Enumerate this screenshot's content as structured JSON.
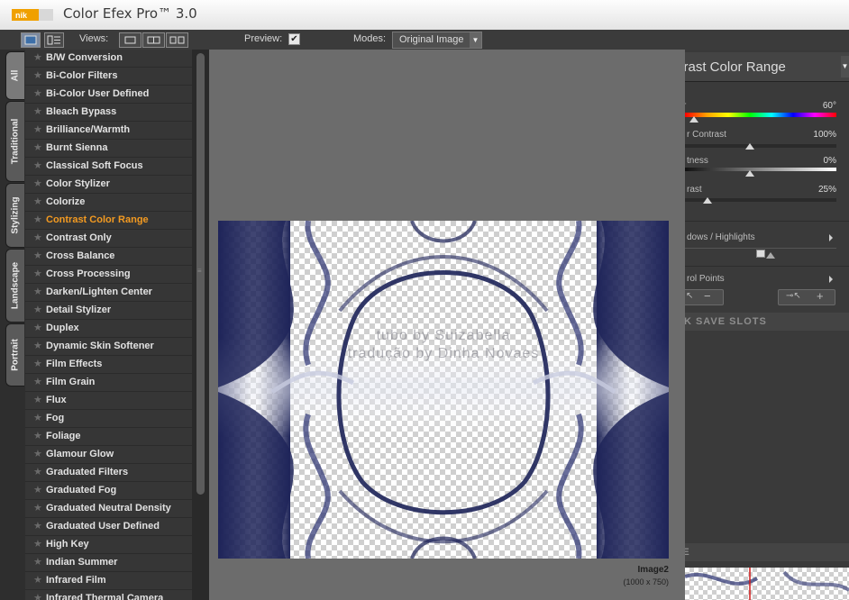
{
  "window": {
    "title": "Color Efex Pro™ 3.0",
    "logo": "nik"
  },
  "toolbar": {
    "views_label": "Views:",
    "preview_label": "Preview:",
    "preview_checked": "✔",
    "modes_label": "Modes:",
    "modes_value": "Original Image"
  },
  "tabs": [
    "All",
    "Traditional",
    "Stylizing",
    "Landscape",
    "Portrait"
  ],
  "filters": [
    "B/W Conversion",
    "Bi-Color Filters",
    "Bi-Color User Defined",
    "Bleach Bypass",
    "Brilliance/Warmth",
    "Burnt Sienna",
    "Classical Soft Focus",
    "Color Stylizer",
    "Colorize",
    "Contrast Color Range",
    "Contrast Only",
    "Cross Balance",
    "Cross Processing",
    "Darken/Lighten Center",
    "Detail Stylizer",
    "Duplex",
    "Dynamic Skin Softener",
    "Film Effects",
    "Film Grain",
    "Flux",
    "Fog",
    "Foliage",
    "Glamour Glow",
    "Graduated Filters",
    "Graduated Fog",
    "Graduated Neutral Density",
    "Graduated User Defined",
    "High Key",
    "Indian Summer",
    "Infrared Film",
    "Infrared Thermal Camera"
  ],
  "active_filter": "Contrast Color Range",
  "preview": {
    "image_name": "Image2",
    "image_dims": "(1000 x 750)",
    "watermark_line1": "tubo by Suizabella",
    "watermark_line2": "tradução by Dinha Novaes"
  },
  "panel": {
    "title": "ntrast Color Range",
    "color_label": "r",
    "color_value": "60°",
    "color_contrast_label": "r Contrast",
    "color_contrast_value": "100%",
    "brightness_label": "tness",
    "brightness_value": "0%",
    "contrast_label": "rast",
    "contrast_value": "25%",
    "shadows_label": "dows / Highlights",
    "control_points_label": "rol Points",
    "quick_save_label": "CK SAVE SLOTS",
    "loupe_label": "PE"
  },
  "colors": {
    "accent": "#f39a21",
    "image_tint": "#1f2559"
  }
}
